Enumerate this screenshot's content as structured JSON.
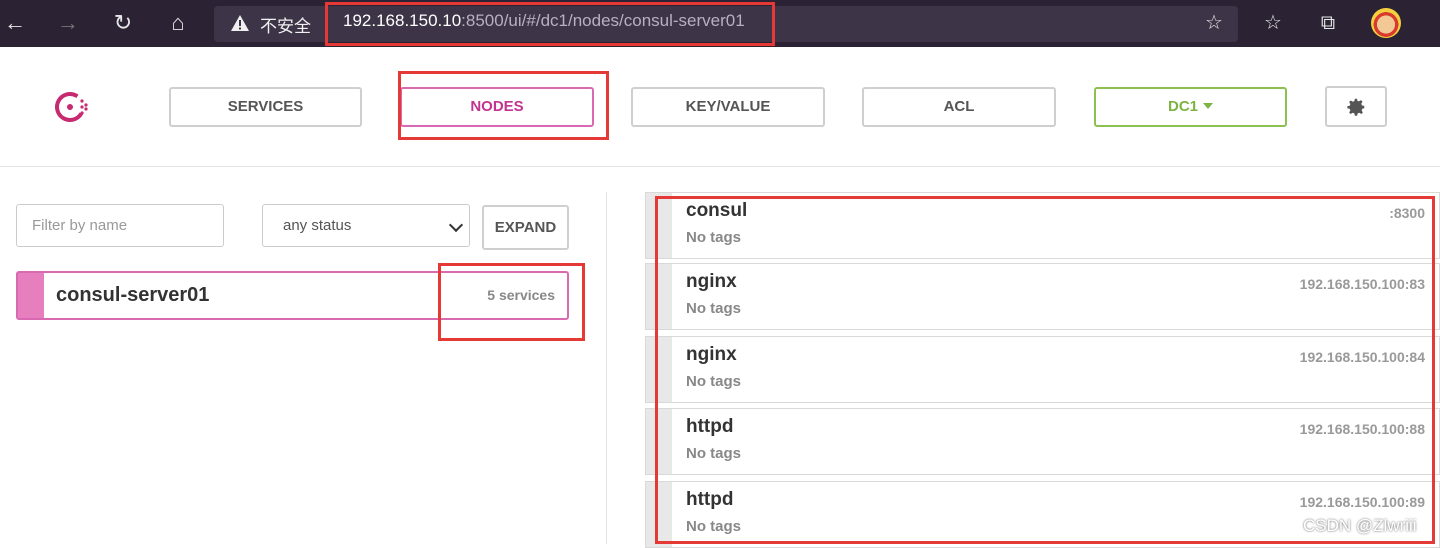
{
  "browser": {
    "insecure_label": "不安全",
    "url_host": "192.168.150.10",
    "url_rest": ":8500/ui/#/dc1/nodes/consul-server01"
  },
  "nav": {
    "services": "SERVICES",
    "nodes": "NODES",
    "keyvalue": "KEY/VALUE",
    "acl": "ACL",
    "datacenter": "DC1"
  },
  "filters": {
    "name_placeholder": "Filter by name",
    "status_selected": "any status",
    "expand_label": "EXPAND"
  },
  "nodes": [
    {
      "name": "consul-server01",
      "services_count": "5 services"
    }
  ],
  "services": [
    {
      "name": "consul",
      "tags": "No tags",
      "address": ":8300"
    },
    {
      "name": "nginx",
      "tags": "No tags",
      "address": "192.168.150.100:83"
    },
    {
      "name": "nginx",
      "tags": "No tags",
      "address": "192.168.150.100:84"
    },
    {
      "name": "httpd",
      "tags": "No tags",
      "address": "192.168.150.100:88"
    },
    {
      "name": "httpd",
      "tags": "No tags",
      "address": "192.168.150.100:89"
    }
  ],
  "watermark": "CSDN @Zlwriii",
  "colors": {
    "accent": "#d96ab2",
    "dc": "#8cc152",
    "highlight": "#e53935"
  }
}
